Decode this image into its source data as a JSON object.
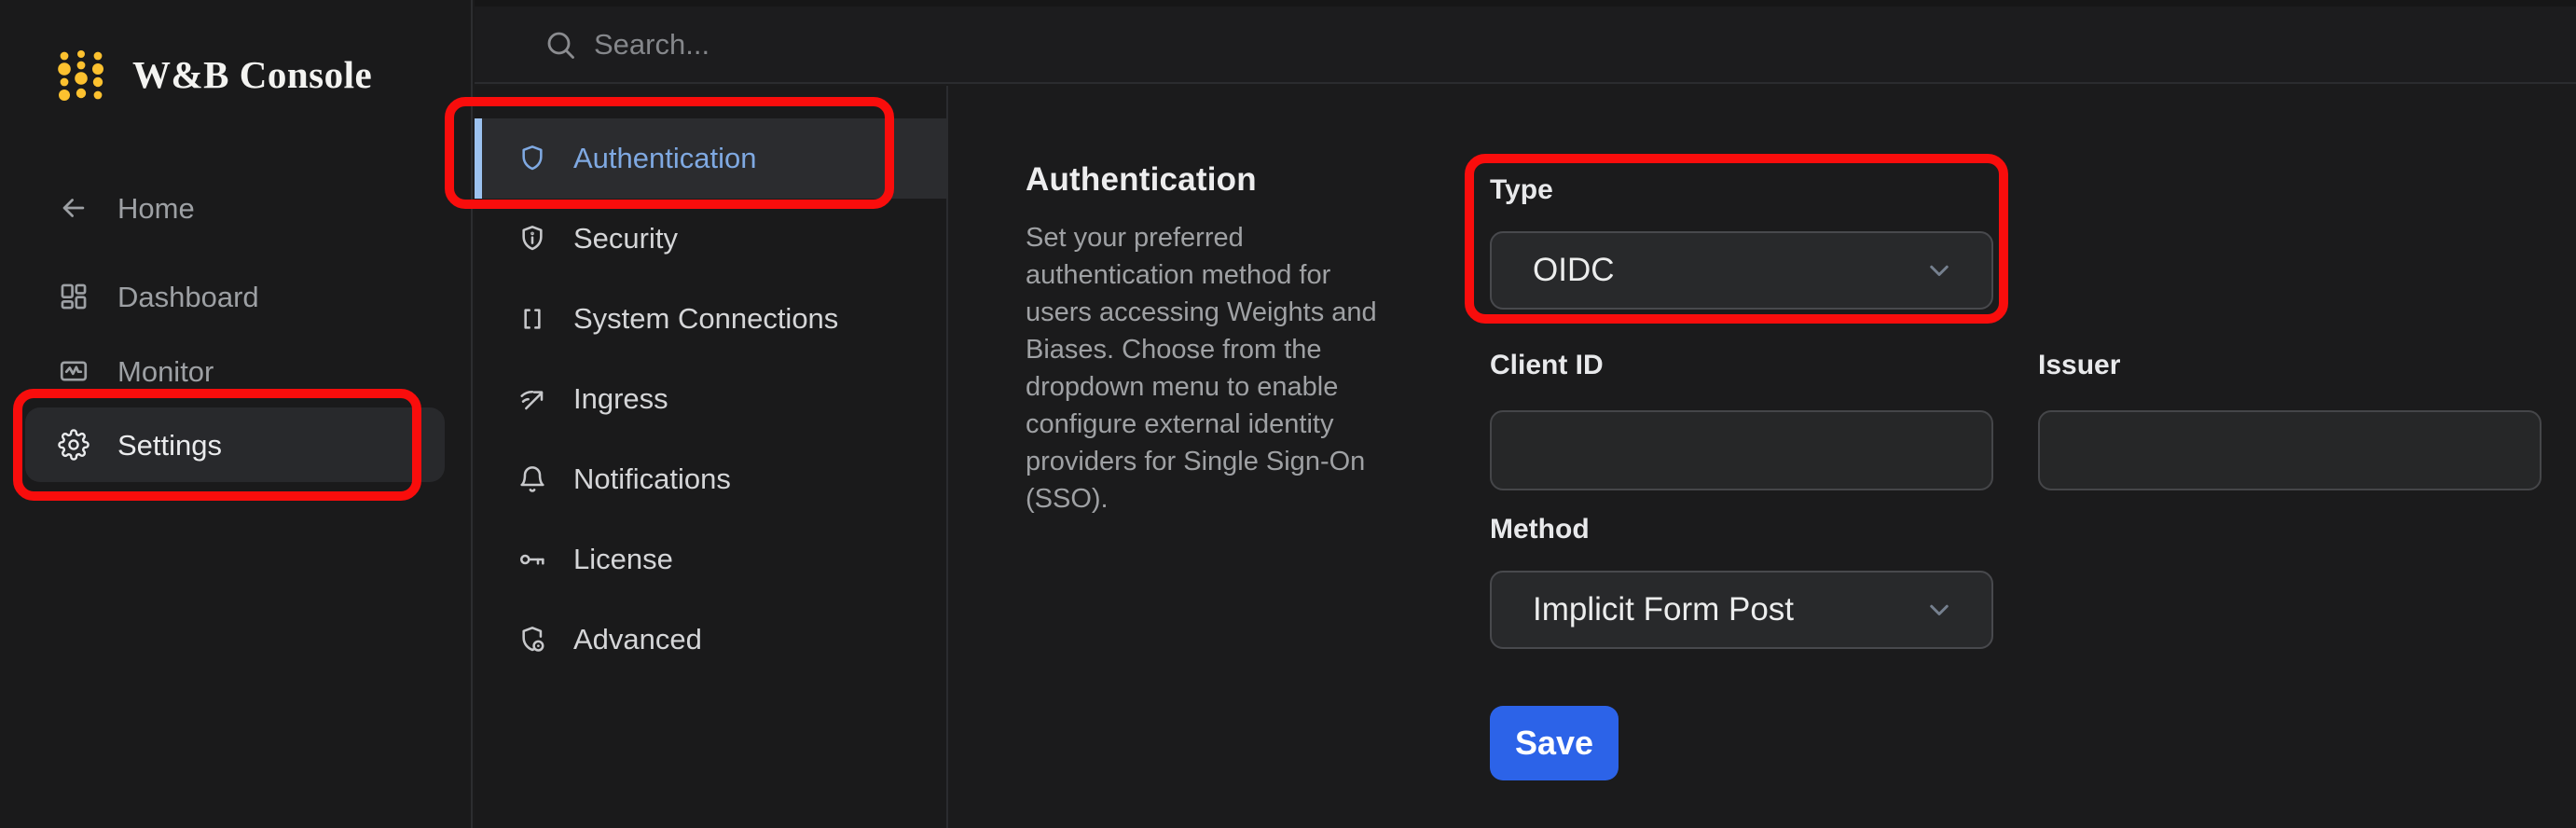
{
  "app": {
    "title": "W&B Console"
  },
  "search": {
    "placeholder": "Search..."
  },
  "sidebar": {
    "items": [
      {
        "label": "Home",
        "icon": "arrow-left-icon"
      },
      {
        "label": "Dashboard",
        "icon": "dashboard-icon"
      },
      {
        "label": "Monitor",
        "icon": "monitor-icon"
      },
      {
        "label": "Settings",
        "icon": "gear-icon",
        "selected": true
      }
    ]
  },
  "settings_nav": {
    "items": [
      {
        "label": "Authentication",
        "icon": "shield-icon",
        "selected": true
      },
      {
        "label": "Security",
        "icon": "shield-info-icon"
      },
      {
        "label": "System Connections",
        "icon": "brackets-icon"
      },
      {
        "label": "Ingress",
        "icon": "signal-arrow-icon"
      },
      {
        "label": "Notifications",
        "icon": "bell-icon"
      },
      {
        "label": "License",
        "icon": "key-icon"
      },
      {
        "label": "Advanced",
        "icon": "shield-gear-icon"
      }
    ]
  },
  "content": {
    "heading": "Authentication",
    "description": "Set your preferred authentication method for users accessing Weights and Biases. Choose from the dropdown menu to enable configure external identity providers for Single Sign-On (SSO).",
    "form": {
      "type_label": "Type",
      "type_value": "OIDC",
      "client_id_label": "Client ID",
      "client_id_value": "",
      "issuer_label": "Issuer",
      "issuer_value": "",
      "method_label": "Method",
      "method_value": "Implicit Form Post",
      "save_label": "Save"
    }
  },
  "colors": {
    "annotation_red": "#f90d0c",
    "accent_blue_text": "#7fa9e2",
    "accent_blue_bar": "#9cc2f0",
    "save_button_blue": "#2c63e8",
    "logo_yellow": "#fcc12f",
    "background_dark": "#1b1b1c"
  },
  "annotations": [
    "red box around Settings sidebar item",
    "red box around Authentication nav item",
    "red box around Type dropdown"
  ]
}
